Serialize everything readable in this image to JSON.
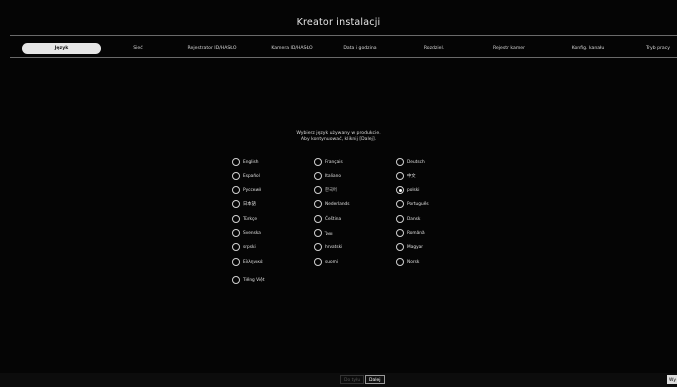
{
  "window": {
    "title": "Kreator instalacji"
  },
  "tabs": [
    {
      "label": "Język",
      "active": true
    },
    {
      "label": "Sieć",
      "active": false
    },
    {
      "label": "Rejestrator ID/HASŁO",
      "active": false
    },
    {
      "label": "Kamera ID/HASŁO",
      "active": false
    },
    {
      "label": "Data i godzina",
      "active": false
    },
    {
      "label": "Rozdziel.",
      "active": false
    },
    {
      "label": "Rejestr kamer",
      "active": false
    },
    {
      "label": "Konfig. kanału",
      "active": false
    },
    {
      "label": "Tryb pracy",
      "active": false
    }
  ],
  "instructions": {
    "line1": "Wybierz język używany w produkcie.",
    "line2": "Aby kontynuować, kliknij [Dalej]."
  },
  "languages": [
    {
      "label": "English",
      "selected": false
    },
    {
      "label": "Français",
      "selected": false
    },
    {
      "label": "Deutsch",
      "selected": false
    },
    {
      "label": "Español",
      "selected": false
    },
    {
      "label": "Italiano",
      "selected": false
    },
    {
      "label": "中文",
      "selected": false
    },
    {
      "label": "Русский",
      "selected": false
    },
    {
      "label": "한국어",
      "selected": false
    },
    {
      "label": "polski",
      "selected": true
    },
    {
      "label": "日本語",
      "selected": false
    },
    {
      "label": "Nederlands",
      "selected": false
    },
    {
      "label": "Português",
      "selected": false
    },
    {
      "label": "Türkçe",
      "selected": false
    },
    {
      "label": "Čeština",
      "selected": false
    },
    {
      "label": "Dansk",
      "selected": false
    },
    {
      "label": "Svenska",
      "selected": false
    },
    {
      "label": "ไทย",
      "selected": false
    },
    {
      "label": "Română",
      "selected": false
    },
    {
      "label": "srpski",
      "selected": false
    },
    {
      "label": "hrvatski",
      "selected": false
    },
    {
      "label": "Magyar",
      "selected": false
    },
    {
      "label": "Ελληνικά",
      "selected": false
    },
    {
      "label": "suomi",
      "selected": false
    },
    {
      "label": "Norsk",
      "selected": false
    },
    {
      "label": "Tiếng Việt",
      "selected": false
    }
  ],
  "footer": {
    "back_label": "Do tyłu",
    "next_label": "Dalej",
    "edge_label": "Wy"
  }
}
